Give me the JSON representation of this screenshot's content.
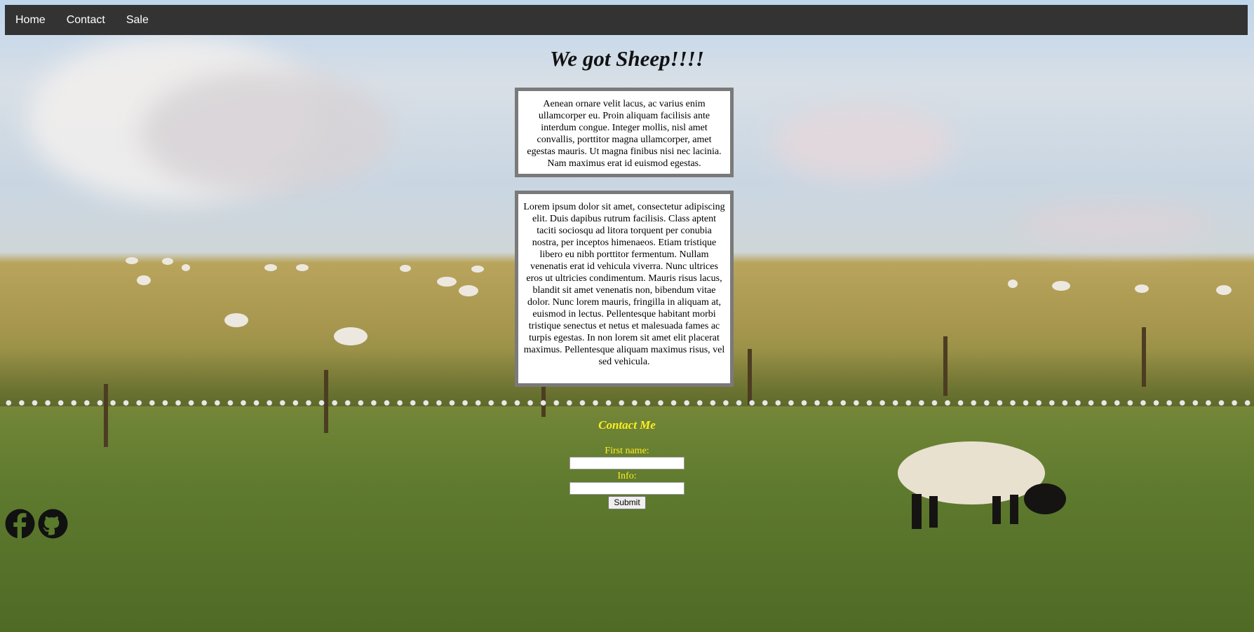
{
  "nav": {
    "items": [
      {
        "label": "Home"
      },
      {
        "label": "Contact"
      },
      {
        "label": "Sale"
      }
    ]
  },
  "heading": "We got Sheep!!!!",
  "boxes": [
    {
      "text": "Aenean ornare velit lacus, ac varius enim ullamcorper eu. Proin aliquam facilisis ante interdum congue. Integer mollis, nisl amet convallis, porttitor magna ullamcorper, amet egestas mauris. Ut magna finibus nisi nec lacinia. Nam maximus erat id euismod egestas."
    },
    {
      "text": "Lorem ipsum dolor sit amet, consectetur adipiscing elit. Duis dapibus rutrum facilisis. Class aptent taciti sociosqu ad litora torquent per conubia nostra, per inceptos himenaeos. Etiam tristique libero eu nibh porttitor fermentum. Nullam venenatis erat id vehicula viverra. Nunc ultrices eros ut ultricies condimentum. Mauris risus lacus, blandit sit amet venenatis non, bibendum vitae dolor. Nunc lorem mauris, fringilla in aliquam at, euismod in lectus. Pellentesque habitant morbi tristique senectus et netus et malesuada fames ac turpis egestas. In non lorem sit amet elit placerat maximus. Pellentesque aliquam maximus risus, vel sed vehicula."
    }
  ],
  "contact": {
    "title": "Contact Me",
    "first_name_label": "First name:",
    "first_name_value": "",
    "info_label": "Info:",
    "info_value": "",
    "submit_label": "Submit"
  },
  "social": {
    "icons": [
      "facebook-icon",
      "github-icon"
    ]
  },
  "colors": {
    "navbar": "#333333",
    "contact_text": "#ffee22",
    "box_border": "#7a7a7a"
  }
}
